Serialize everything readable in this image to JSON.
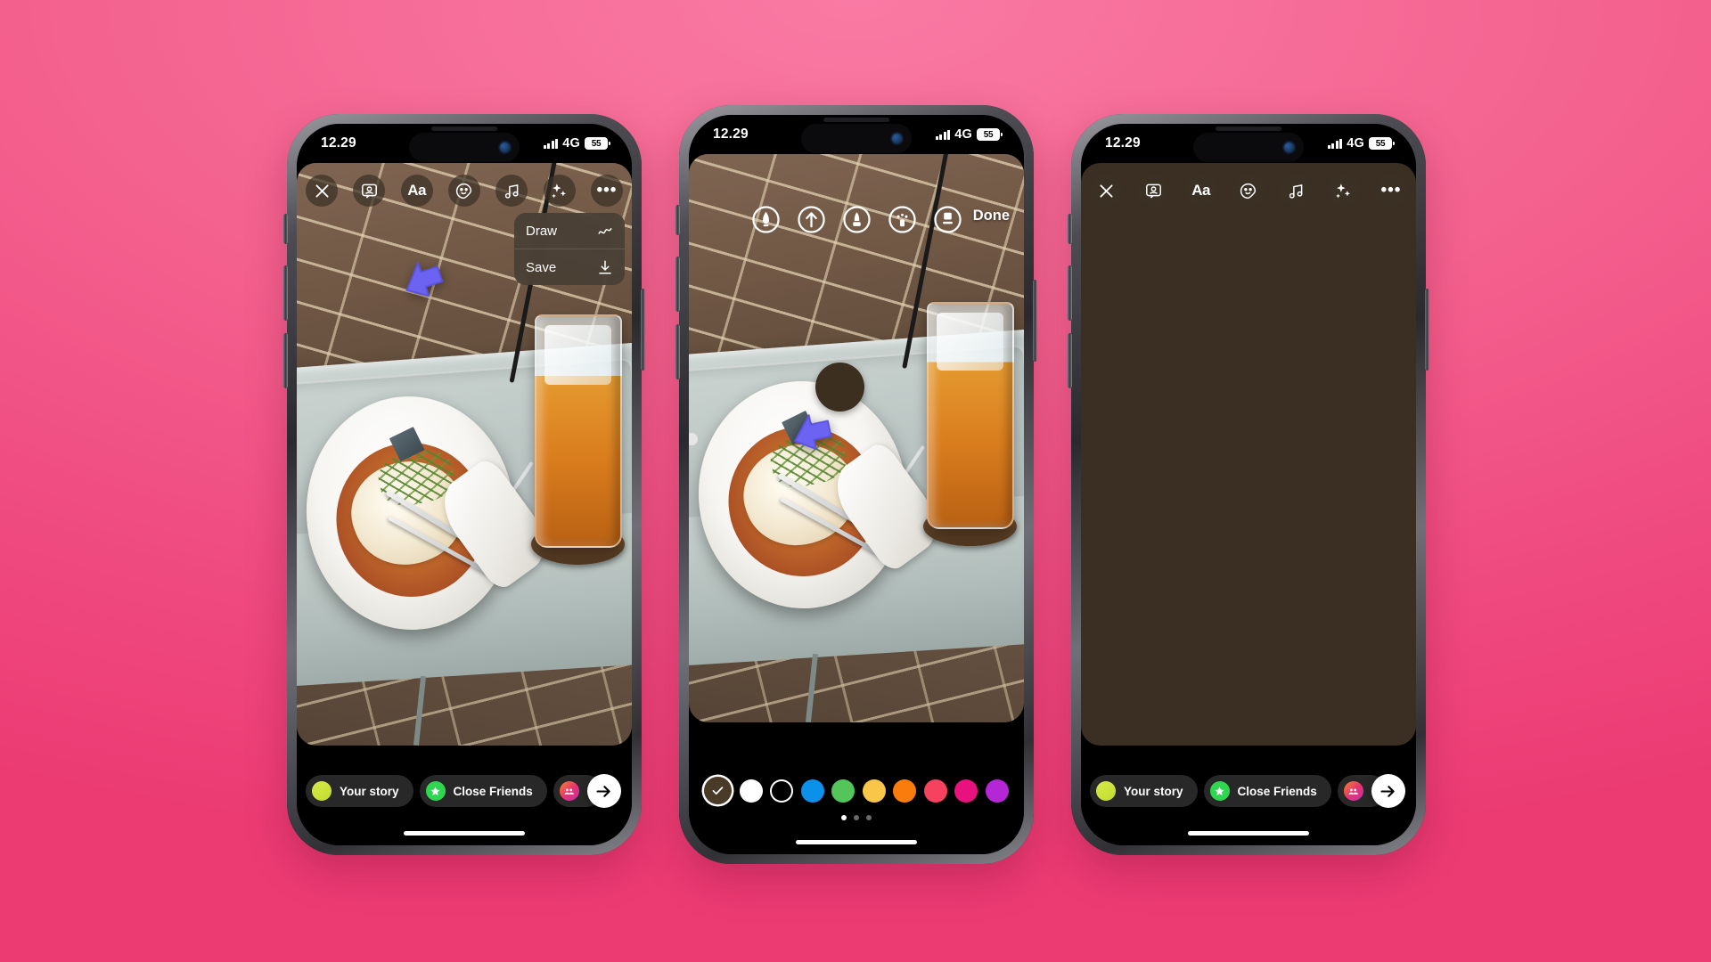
{
  "background": {
    "color_top": "#f97aa4",
    "color_bottom": "#ec3b73"
  },
  "status_bar": {
    "time": "12.29",
    "network": "4G",
    "battery": "55"
  },
  "toolbar": {
    "close_label": "X",
    "items": [
      {
        "name": "close-icon",
        "label": "Close"
      },
      {
        "name": "your-story-icon",
        "label": "Your story"
      },
      {
        "name": "text-icon",
        "label": "Aa"
      },
      {
        "name": "sticker-icon",
        "label": "Stickers"
      },
      {
        "name": "music-icon",
        "label": "Music"
      },
      {
        "name": "effects-icon",
        "label": "Effects"
      },
      {
        "name": "more-icon",
        "label": "More"
      }
    ]
  },
  "context_menu": {
    "items": [
      {
        "label": "Draw",
        "icon": "squiggle-icon"
      },
      {
        "label": "Save",
        "icon": "download-icon"
      }
    ]
  },
  "draw_mode": {
    "done_label": "Done",
    "tools": [
      {
        "name": "pen-tool-icon",
        "label": "Pen"
      },
      {
        "name": "arrow-tool-icon",
        "label": "Arrow"
      },
      {
        "name": "marker-tool-icon",
        "label": "Marker"
      },
      {
        "name": "neon-tool-icon",
        "label": "Neon"
      },
      {
        "name": "eraser-tool-icon",
        "label": "Eraser"
      }
    ],
    "colors": [
      {
        "hex": "#4a3a28",
        "selected": true,
        "outline": false
      },
      {
        "hex": "#ffffff",
        "selected": false,
        "outline": false
      },
      {
        "hex": "#000000",
        "selected": false,
        "outline": true
      },
      {
        "hex": "#0c91eb",
        "selected": false,
        "outline": false
      },
      {
        "hex": "#54c55a",
        "selected": false,
        "outline": false
      },
      {
        "hex": "#f9c council",
        "selected": false,
        "outline": false
      },
      {
        "hex": "#f97c0c",
        "selected": false,
        "outline": false
      },
      {
        "hex": "#f6415f",
        "selected": false,
        "outline": false
      },
      {
        "hex": "#e8127f",
        "selected": false,
        "outline": false
      },
      {
        "hex": "#b426d6",
        "selected": false,
        "outline": false
      }
    ],
    "page_dots": [
      true,
      false,
      false
    ]
  },
  "action_bar": {
    "your_story": "Your story",
    "close_friends": "Close Friends",
    "group_label": "",
    "next_icon": "arrow-right-icon"
  },
  "phones": [
    {
      "id": "phone-1",
      "state": "menu-open",
      "canvas": "photo"
    },
    {
      "id": "phone-2",
      "state": "draw-mode",
      "canvas": "photo"
    },
    {
      "id": "phone-3",
      "state": "plain",
      "canvas": "solid-brown"
    }
  ]
}
